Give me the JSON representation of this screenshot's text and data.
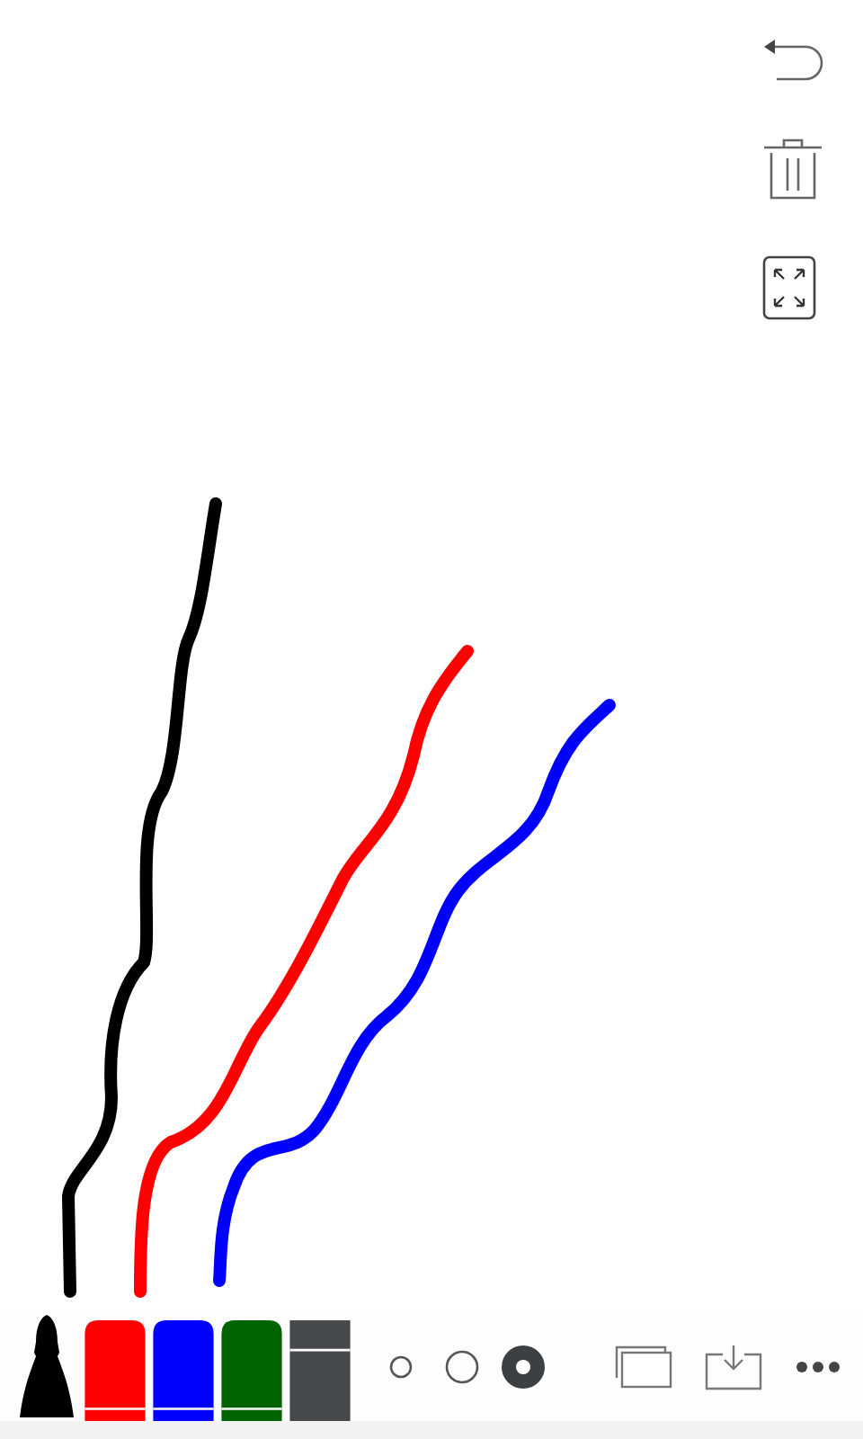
{
  "strokes": [
    {
      "color": "#000000"
    },
    {
      "color": "#ff0000"
    },
    {
      "color": "#0000ff"
    }
  ],
  "pens": [
    {
      "kind": "marker",
      "color": "#000000",
      "selected": true
    },
    {
      "kind": "pen",
      "color": "#ff0000",
      "selected": false
    },
    {
      "kind": "pen",
      "color": "#0000ff",
      "selected": false
    },
    {
      "kind": "pen",
      "color": "#006400",
      "selected": false
    },
    {
      "kind": "eraser",
      "color": "#464a4d",
      "selected": false
    }
  ],
  "sizes": [
    {
      "selected": false
    },
    {
      "selected": false
    },
    {
      "selected": true
    }
  ]
}
